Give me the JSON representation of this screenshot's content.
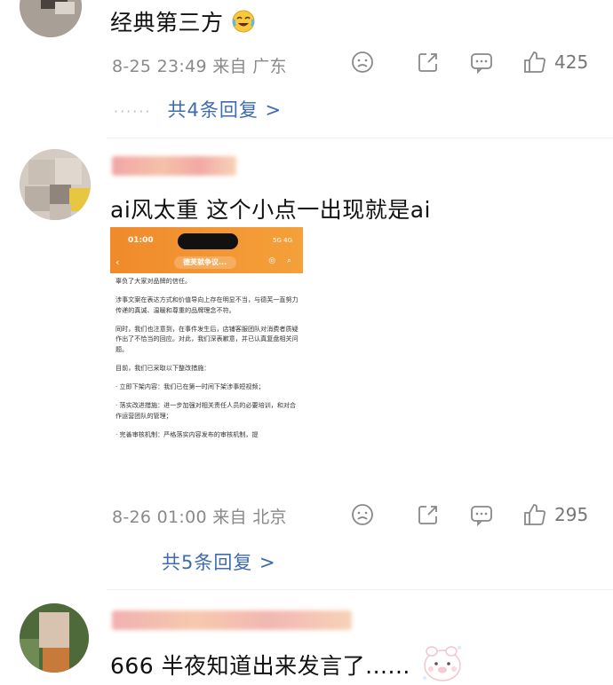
{
  "comments": [
    {
      "text": "经典第三方",
      "emoji_icon": "laughing-crying-emoji",
      "meta": "8-25 23:49 来自 广东",
      "likes": "425",
      "replies_dots": "······",
      "replies_label": "共4条回复 >"
    },
    {
      "text": "ai风太重 这个小点一出现就是ai",
      "meta": "8-26 01:00 来自 北京",
      "likes": "295",
      "replies_label": "共5条回复 >",
      "screenshot": {
        "time": "01:00",
        "status": "5G 4G",
        "title": "德芙就争议...",
        "paragraphs": [
          "辜负了大家对品牌的信任。",
          "涉事文案在表达方式和价值导向上存在明显不当，与德芙一直努力传递的真诚、温暖和尊重的品牌理念不符。",
          "同时，我们也注意到，在事件发生后，店铺客服团队对消费者质疑作出了不恰当的回应。对此，我们深表歉意，并已认真复盘相关问题。",
          "目前，我们已采取以下整改措施：",
          "· 立即下架内容：我们已在第一时间下架涉事短视频；",
          "· 落实改进措施：进一步加强对相关责任人员的必要培训，和对合作运营团队的管理；",
          "· 完善审核机制：严格落实内容发布的审核机制，提"
        ]
      }
    },
    {
      "text": "666 半夜知道出来发言了......",
      "sticker_icon": "cute-pig-sticker"
    }
  ],
  "colors": {
    "reply_link": "#3d6ab3",
    "meta": "#8a8a8a",
    "orange_header": "#f08a2b"
  },
  "icons": [
    "dislike-icon",
    "share-icon",
    "comment-icon",
    "like-icon"
  ]
}
